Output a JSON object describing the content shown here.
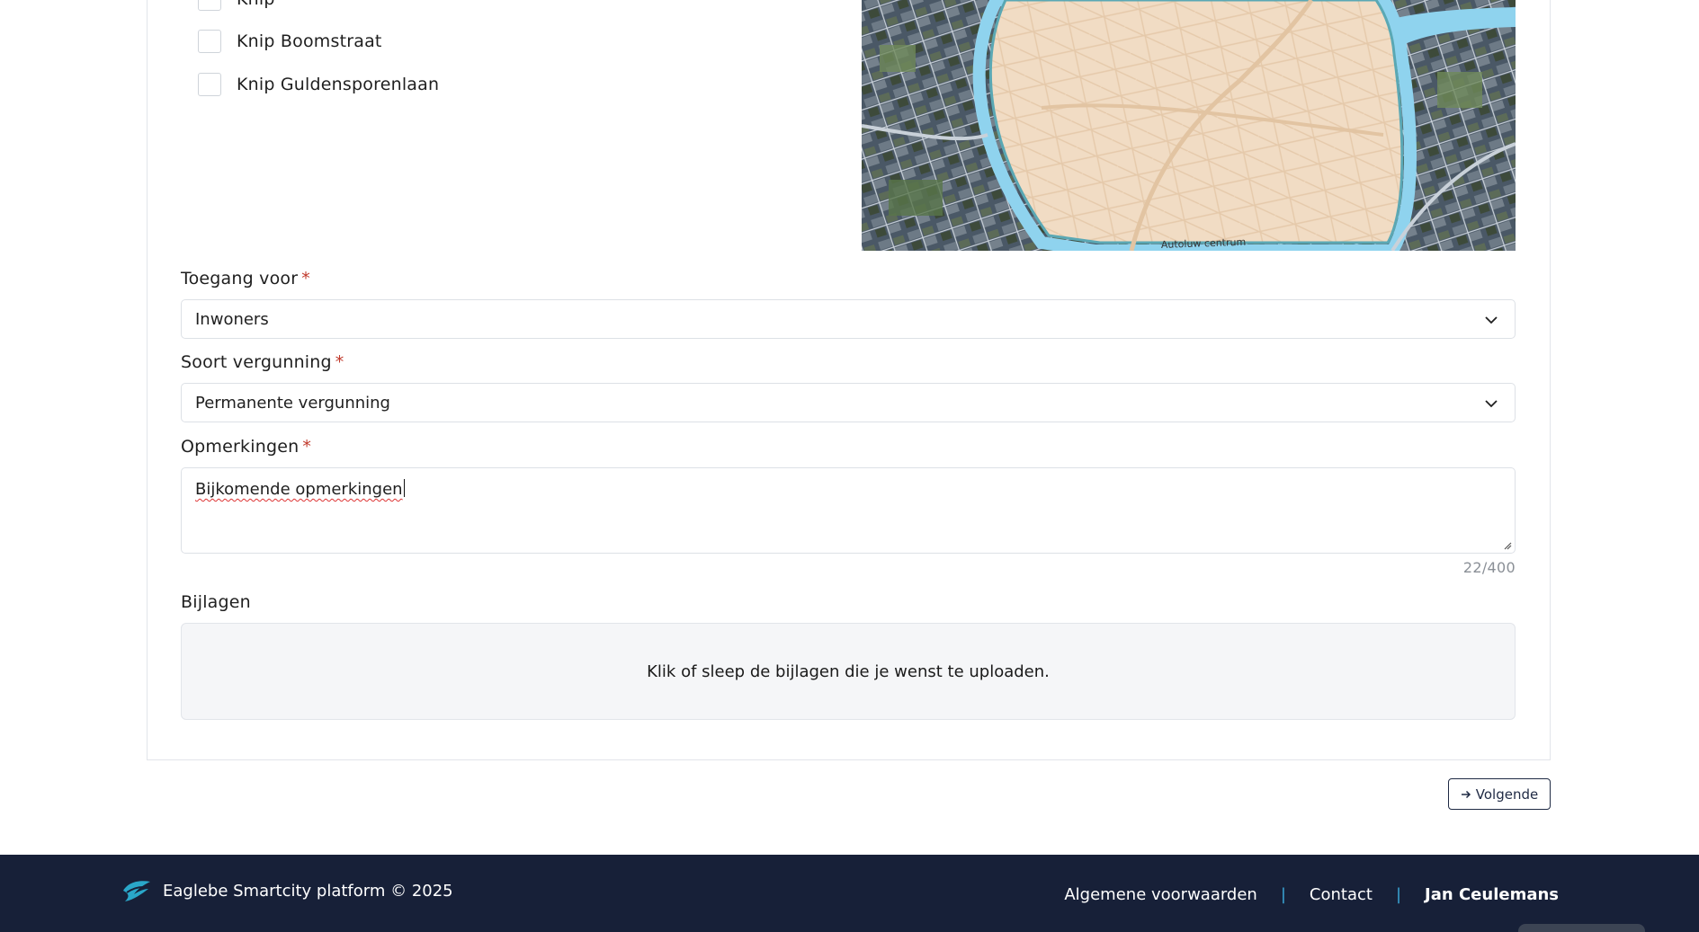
{
  "form": {
    "options": [
      {
        "label": "Knip"
      },
      {
        "label": "Knip Boomstraat"
      },
      {
        "label": "Knip Guldensporenlaan"
      }
    ],
    "map": {
      "road_label": "Autoluw centrum"
    },
    "access": {
      "label": "Toegang voor",
      "required_mark": "*",
      "value": "Inwoners"
    },
    "permit_type": {
      "label": "Soort vergunning",
      "required_mark": "*",
      "value": "Permanente vergunning"
    },
    "remarks": {
      "label": "Opmerkingen",
      "required_mark": "*",
      "value": "Bijkomende opmerkingen",
      "counter": "22/400"
    },
    "attachments": {
      "label": "Bijlagen",
      "dropzone_text": "Klik of sleep de bijlagen die je wenst te uploaden."
    },
    "next_button": {
      "label": "Volgende"
    }
  },
  "footer": {
    "brand": "Eaglebe Smartcity platform © 2025",
    "links": [
      {
        "label": "Algemene voorwaarden"
      },
      {
        "label": "Contact"
      }
    ],
    "separator": "|",
    "user": "Jan Ceulemans"
  },
  "colors": {
    "required": "#c0392b",
    "footer_bg": "#172038",
    "footer_separator": "#3aa6d6",
    "button_border": "#1f2a44",
    "map_zone": "#f1dcc4",
    "map_water": "#8fd3ee"
  }
}
